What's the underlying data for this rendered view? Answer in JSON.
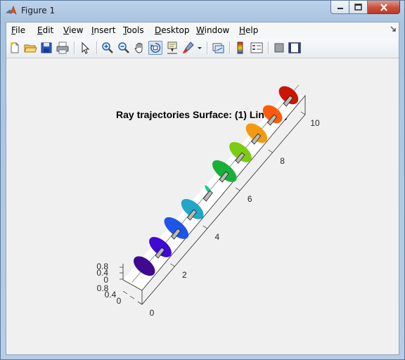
{
  "window": {
    "title": "Figure 1"
  },
  "menu": [
    {
      "label": "File",
      "accel": "F",
      "rest": "ile"
    },
    {
      "label": "Edit",
      "accel": "E",
      "rest": "dit"
    },
    {
      "label": "View",
      "accel": "V",
      "rest": "iew"
    },
    {
      "label": "Insert",
      "accel": "I",
      "rest": "nsert"
    },
    {
      "label": "Tools",
      "accel": "T",
      "rest": "ools"
    },
    {
      "label": "Desktop",
      "accel": "D",
      "rest": "esktop"
    },
    {
      "label": "Window",
      "accel": "W",
      "rest": "indow"
    },
    {
      "label": "Help",
      "accel": "H",
      "rest": "elp"
    }
  ],
  "toolbar": {
    "icons": [
      "new-figure-icon",
      "open-file-icon",
      "save-icon",
      "print-icon",
      "edit-plot-icon",
      "zoom-in-icon",
      "zoom-out-icon",
      "pan-icon",
      "rotate-3d-icon",
      "data-cursor-icon",
      "brush-icon",
      "link-plot-icon",
      "insert-colorbar-icon",
      "insert-legend-icon",
      "hide-plot-tools-icon",
      "show-plot-tools-icon"
    ],
    "active": "rotate-3d-icon"
  },
  "plot": {
    "title": "Ray trajectories Surface:  (1) Line:  (1)",
    "x_ticks": [
      "0",
      "2",
      "4",
      "6",
      "8",
      "10"
    ],
    "y_ticks": [
      "0",
      "0.4",
      "0.8"
    ],
    "z_ticks": [
      "0",
      "0.4",
      "0.8"
    ],
    "colors": [
      "#3d0a91",
      "#3f0ad2",
      "#1f55e6",
      "#22a6c8",
      "#1cc98f",
      "#19b03a",
      "#7ccc12",
      "#f39a10",
      "#ff5a0a",
      "#cc1400"
    ]
  }
}
